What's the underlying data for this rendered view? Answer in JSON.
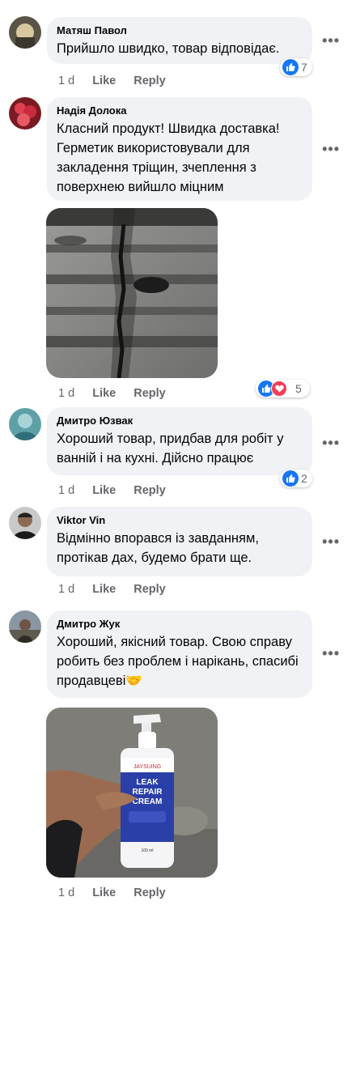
{
  "actions": {
    "like": "Like",
    "reply": "Reply"
  },
  "comments": [
    {
      "author": "Матяш Павол",
      "text": "Прийшло швидко, товар відповідає.",
      "time": "1 d",
      "reactions": "7",
      "more": "•••"
    },
    {
      "author": "Надія Долока",
      "text": "Класний продукт! Швидка доставка! Герметик використовували для закладення тріщин, зчеплення з поверхнею вийшло міцним",
      "time": "1 d",
      "reactions": "5",
      "more": "•••"
    },
    {
      "author": "Дмитро Юзвак",
      "text": "Хороший товар, придбав для робіт у ванній і на кухні. Дійсно працює",
      "time": "1 d",
      "reactions": "2",
      "more": "•••"
    },
    {
      "author": "Viktor Vin",
      "text": "Відмінно впорався із завданням, протікав дах, будемо брати ще.",
      "time": "1 d",
      "more": "•••"
    },
    {
      "author": "Дмитро Жук",
      "text": "Хороший, якісний товар. Свою справу робить без проблем і нарікань, спасибі продавцеві🤝",
      "time": "1 d",
      "more": "•••"
    }
  ],
  "product": {
    "brand": "JAYSUING",
    "name_line1": "LEAK",
    "name_line2": "REPAIR",
    "name_line3": "CREAM",
    "volume": "100 ml"
  }
}
